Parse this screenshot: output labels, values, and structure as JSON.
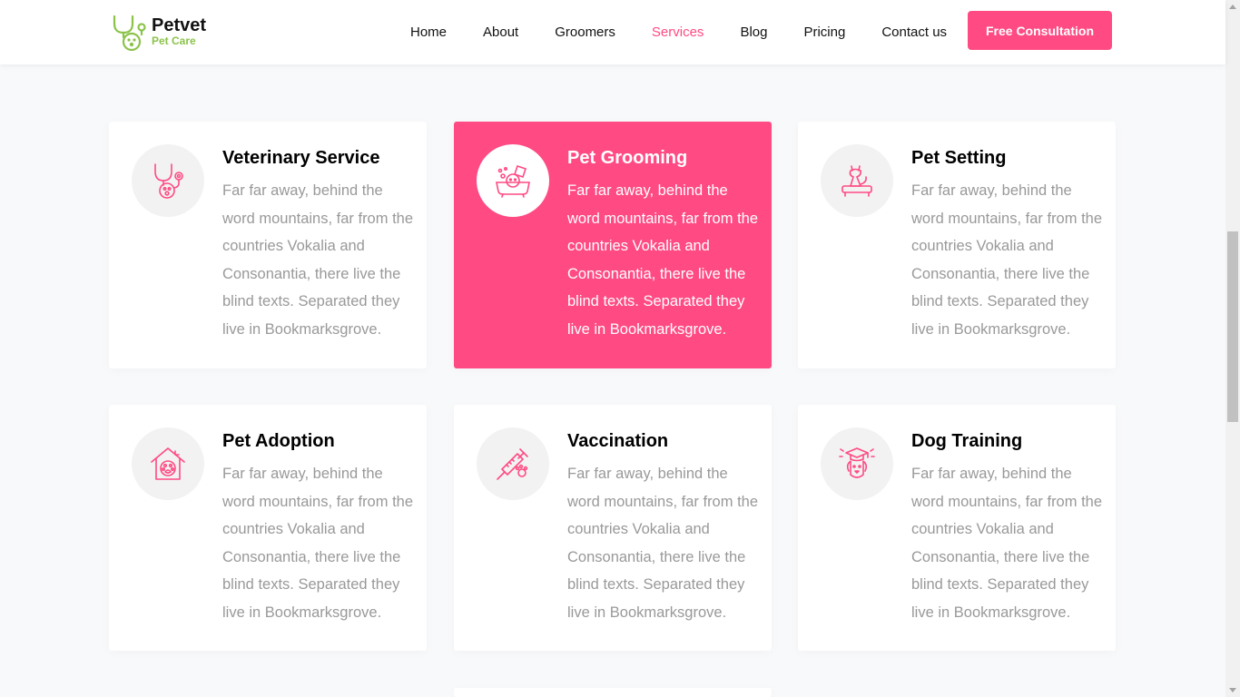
{
  "brand": {
    "name": "Petvet",
    "subtitle": "Pet Care"
  },
  "nav": {
    "items": [
      {
        "label": "Home",
        "active": false
      },
      {
        "label": "About",
        "active": false
      },
      {
        "label": "Groomers",
        "active": false
      },
      {
        "label": "Services",
        "active": true
      },
      {
        "label": "Blog",
        "active": false
      },
      {
        "label": "Pricing",
        "active": false
      },
      {
        "label": "Contact us",
        "active": false
      }
    ],
    "cta_label": "Free Consultation"
  },
  "colors": {
    "accent": "#ff4a83",
    "brand_green": "#8bc34a",
    "text_muted": "#999999"
  },
  "services": [
    {
      "title": "Veterinary Service",
      "icon": "stethoscope-icon",
      "featured": false,
      "text": "Far far away, behind the word mountains, far from the countries Vokalia and Consonantia, there live the blind texts. Separated they live in Bookmarksgrove."
    },
    {
      "title": "Pet Grooming",
      "icon": "pet-grooming-icon",
      "featured": true,
      "text": "Far far away, behind the word mountains, far from the countries Vokalia and Consonantia, there live the blind texts. Separated they live in Bookmarksgrove."
    },
    {
      "title": "Pet Setting",
      "icon": "cat-bed-icon",
      "featured": false,
      "text": "Far far away, behind the word mountains, far from the countries Vokalia and Consonantia, there live the blind texts. Separated they live in Bookmarksgrove."
    },
    {
      "title": "Pet Adoption",
      "icon": "pet-house-icon",
      "featured": false,
      "text": "Far far away, behind the word mountains, far from the countries Vokalia and Consonantia, there live the blind texts. Separated they live in Bookmarksgrove."
    },
    {
      "title": "Vaccination",
      "icon": "syringe-icon",
      "featured": false,
      "text": "Far far away, behind the word mountains, far from the countries Vokalia and Consonantia, there live the blind texts. Separated they live in Bookmarksgrove."
    },
    {
      "title": "Dog Training",
      "icon": "dog-graduate-icon",
      "featured": false,
      "text": "Far far away, behind the word mountains, far from the countries Vokalia and Consonantia, there live the blind texts. Separated they live in Bookmarksgrove."
    }
  ]
}
